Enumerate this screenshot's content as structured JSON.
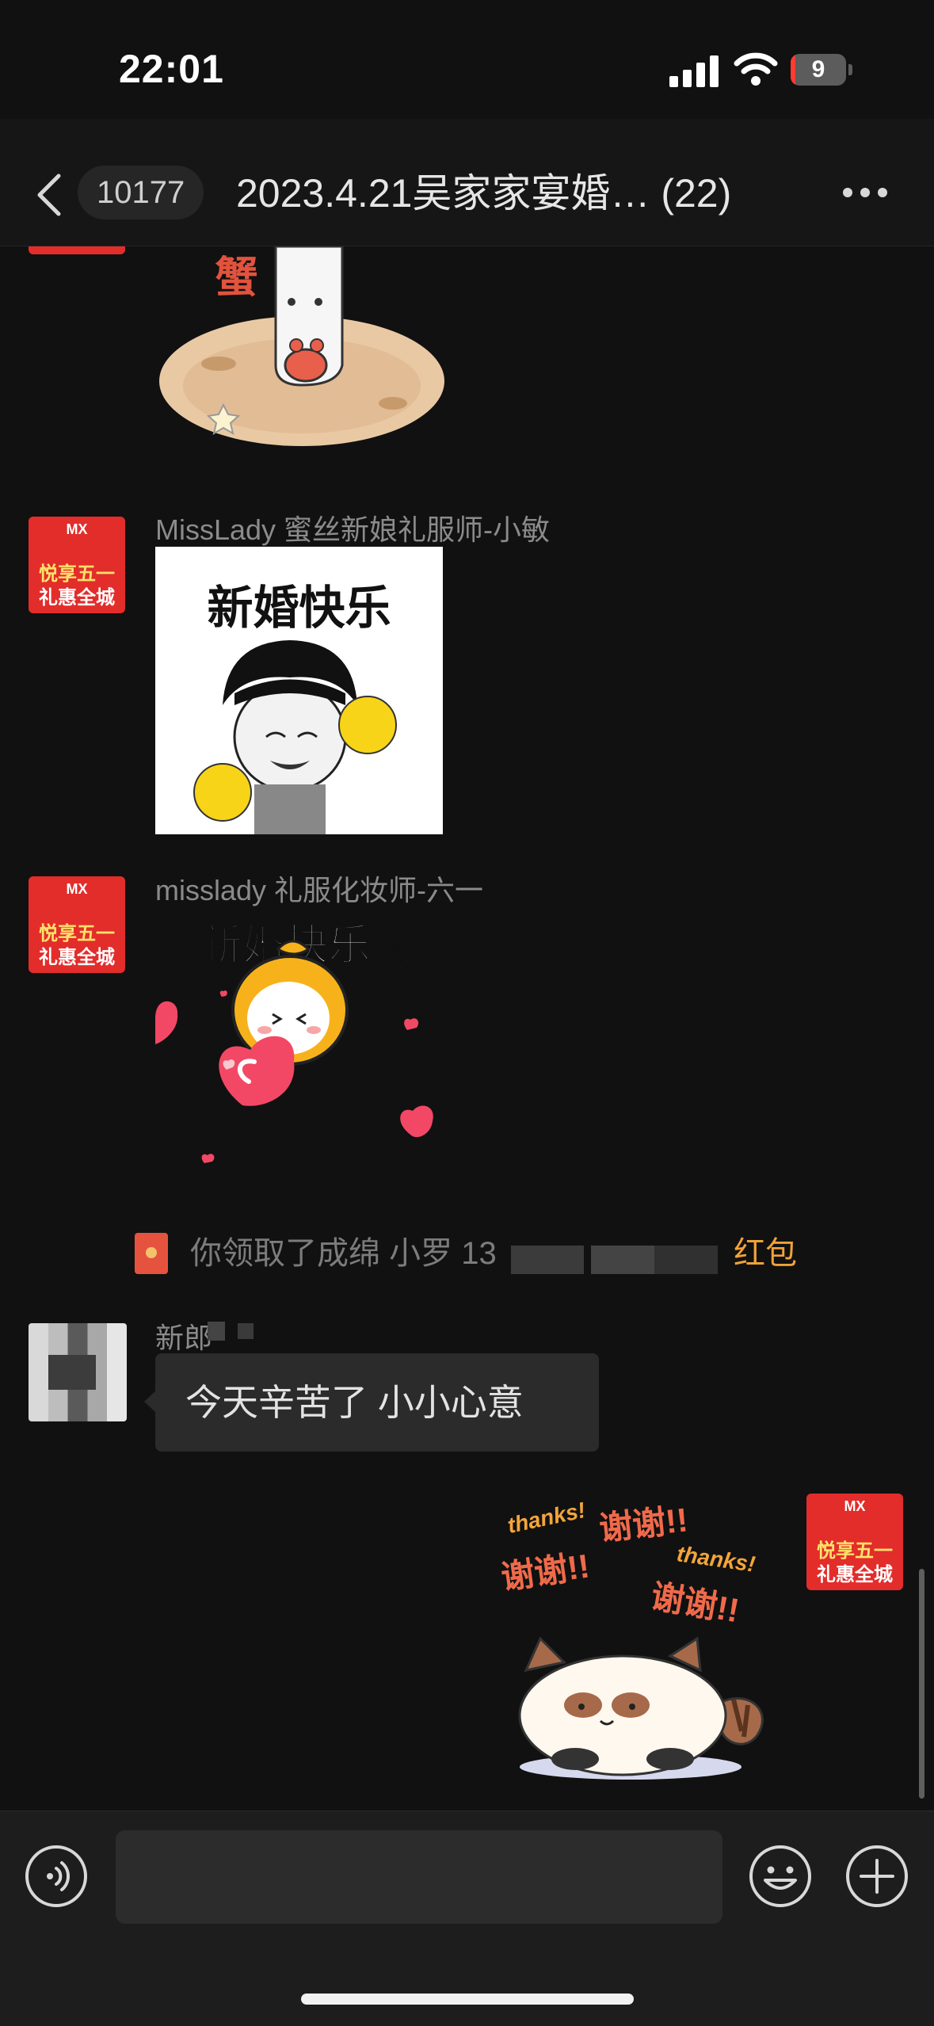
{
  "status_bar": {
    "time": "22:01",
    "battery": "9",
    "battery_level": 0.09
  },
  "header": {
    "unread_count": "10177",
    "title": "2023.4.21吴家家宴婚… (22)"
  },
  "messages": [
    {
      "type": "sticker",
      "side": "left",
      "sticker_text": "蟹",
      "description_icon": "crab-sticker"
    },
    {
      "type": "sticker",
      "side": "left",
      "sender": "MissLady 蜜丝新娘礼服师-小敏",
      "sticker_text": "新婚快乐"
    },
    {
      "type": "sticker",
      "side": "left",
      "sender": "misslady 礼服化妆师-六一",
      "sticker_text": "新婚快乐鸭"
    },
    {
      "type": "system",
      "text": "你领取了成绵 小罗 13",
      "link_text": "红包"
    },
    {
      "type": "text",
      "side": "left",
      "sender": "新郎",
      "text": "今天辛苦了 小小心意"
    },
    {
      "type": "sticker",
      "side": "right",
      "sticker_texts": [
        "thanks!",
        "谢谢!!",
        "谢谢!!",
        "thanks!",
        "谢谢!!"
      ]
    }
  ],
  "avatar_badge": {
    "brand": "MX",
    "line1": "悦享五一",
    "line2": "礼惠全城"
  },
  "colors": {
    "background": "#111111",
    "bubble": "#2b2b2b",
    "red_packet_link": "#f0a23a",
    "avatar_red": "#e22d2b"
  },
  "input": {
    "placeholder": ""
  }
}
